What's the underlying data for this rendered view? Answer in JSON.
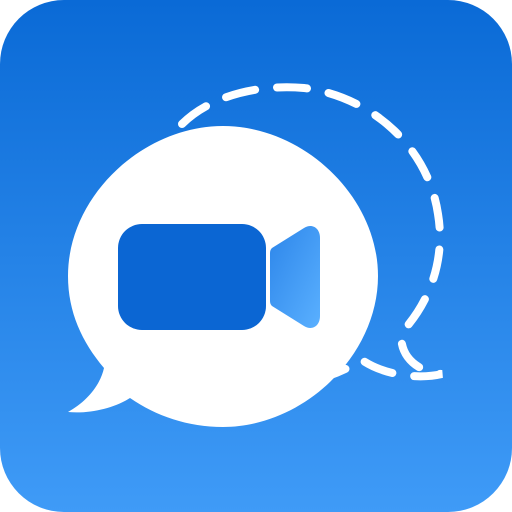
{
  "icon": {
    "name": "video-chat-app-icon",
    "depicts": [
      "speech-bubble-icon",
      "dashed-speech-bubble-icon",
      "video-camera-icon"
    ]
  },
  "colors": {
    "background_top": "#0a6ad6",
    "background_bottom": "#3f9bf7",
    "bubble_fill": "#ffffff",
    "dashed_outline": "#ffffff",
    "camera_body": "#0b66d3",
    "camera_lens_top": "#2d86ea",
    "camera_lens_bottom": "#5ab0ff"
  }
}
